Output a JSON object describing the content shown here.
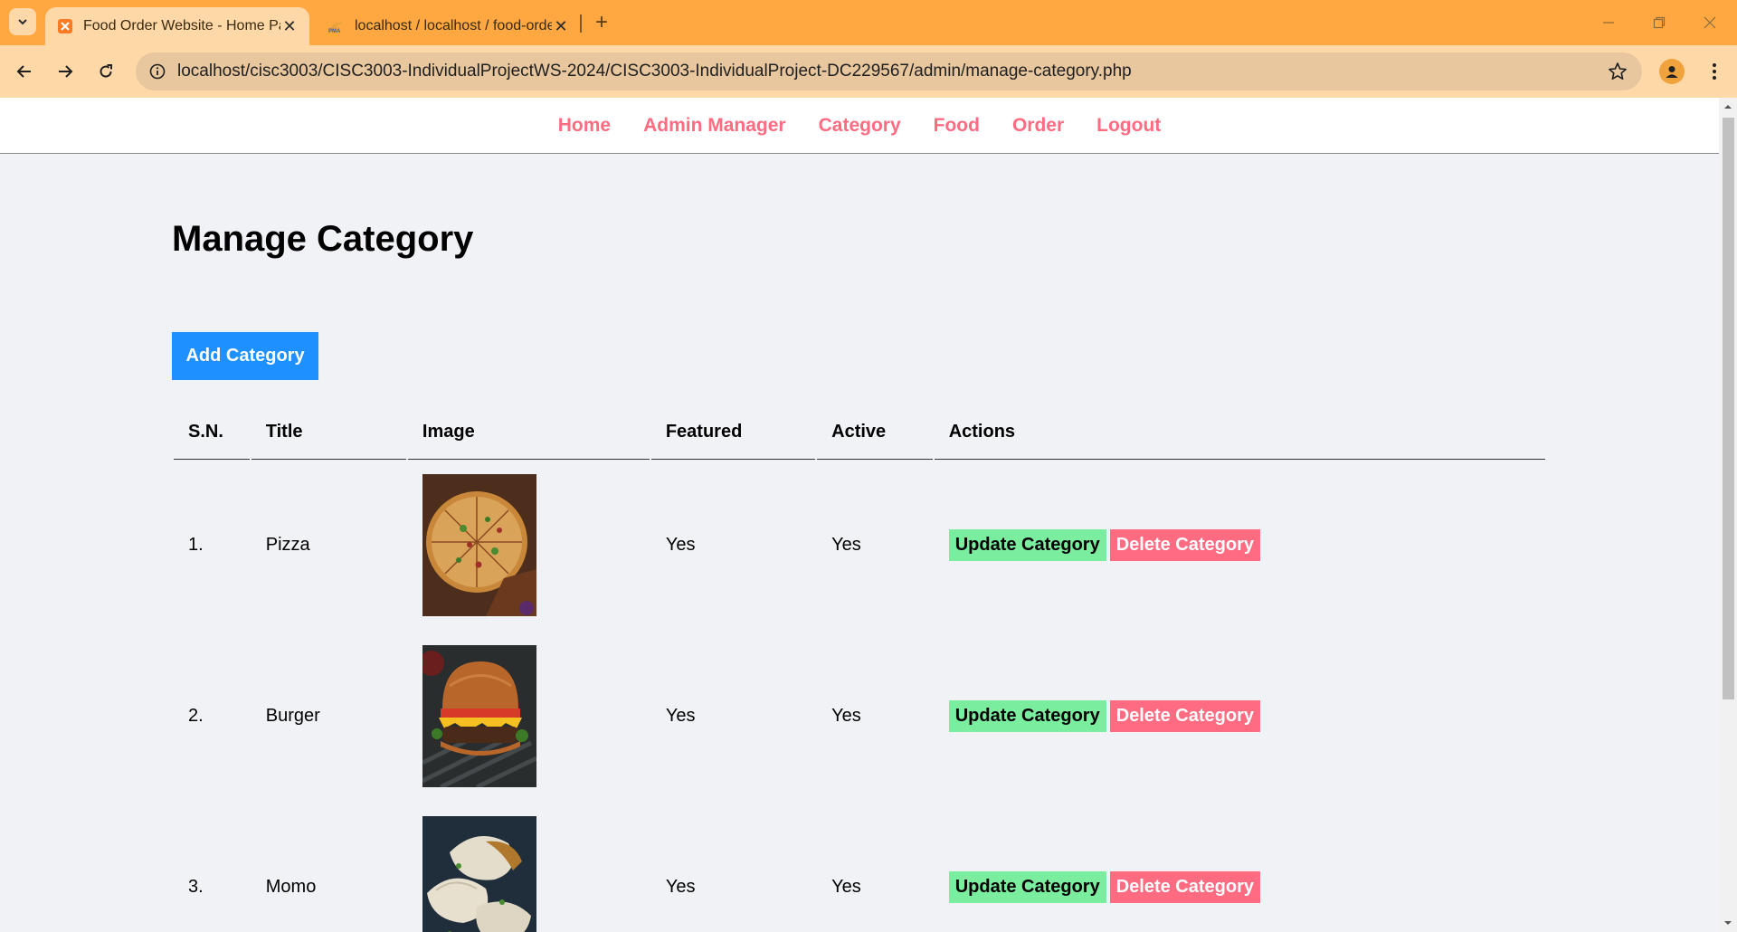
{
  "browser": {
    "tabs": [
      {
        "title": "Food Order Website - Home Page",
        "active": true
      },
      {
        "title": "localhost / localhost / food-order",
        "active": false
      }
    ],
    "url": "localhost/cisc3003/CISC3003-IndividualProjectWS-2024/CISC3003-IndividualProject-DC229567/admin/manage-category.php"
  },
  "nav": {
    "items": [
      "Home",
      "Admin Manager",
      "Category",
      "Food",
      "Order",
      "Logout"
    ]
  },
  "page": {
    "heading": "Manage Category",
    "add_button": "Add Category"
  },
  "table": {
    "headers": [
      "S.N.",
      "Title",
      "Image",
      "Featured",
      "Active",
      "Actions"
    ],
    "rows": [
      {
        "sn": "1.",
        "title": "Pizza",
        "image": "pizza",
        "featured": "Yes",
        "active": "Yes"
      },
      {
        "sn": "2.",
        "title": "Burger",
        "image": "burger",
        "featured": "Yes",
        "active": "Yes"
      },
      {
        "sn": "3.",
        "title": "Momo",
        "image": "momo",
        "featured": "Yes",
        "active": "Yes"
      }
    ],
    "update_label": "Update Category",
    "delete_label": "Delete Category"
  },
  "colors": {
    "accent": "#ff6b81",
    "primary_button": "#1e90ff",
    "update_button": "#7bed9f",
    "background": "#f1f2f6",
    "browser_frame": "#ffa842"
  }
}
